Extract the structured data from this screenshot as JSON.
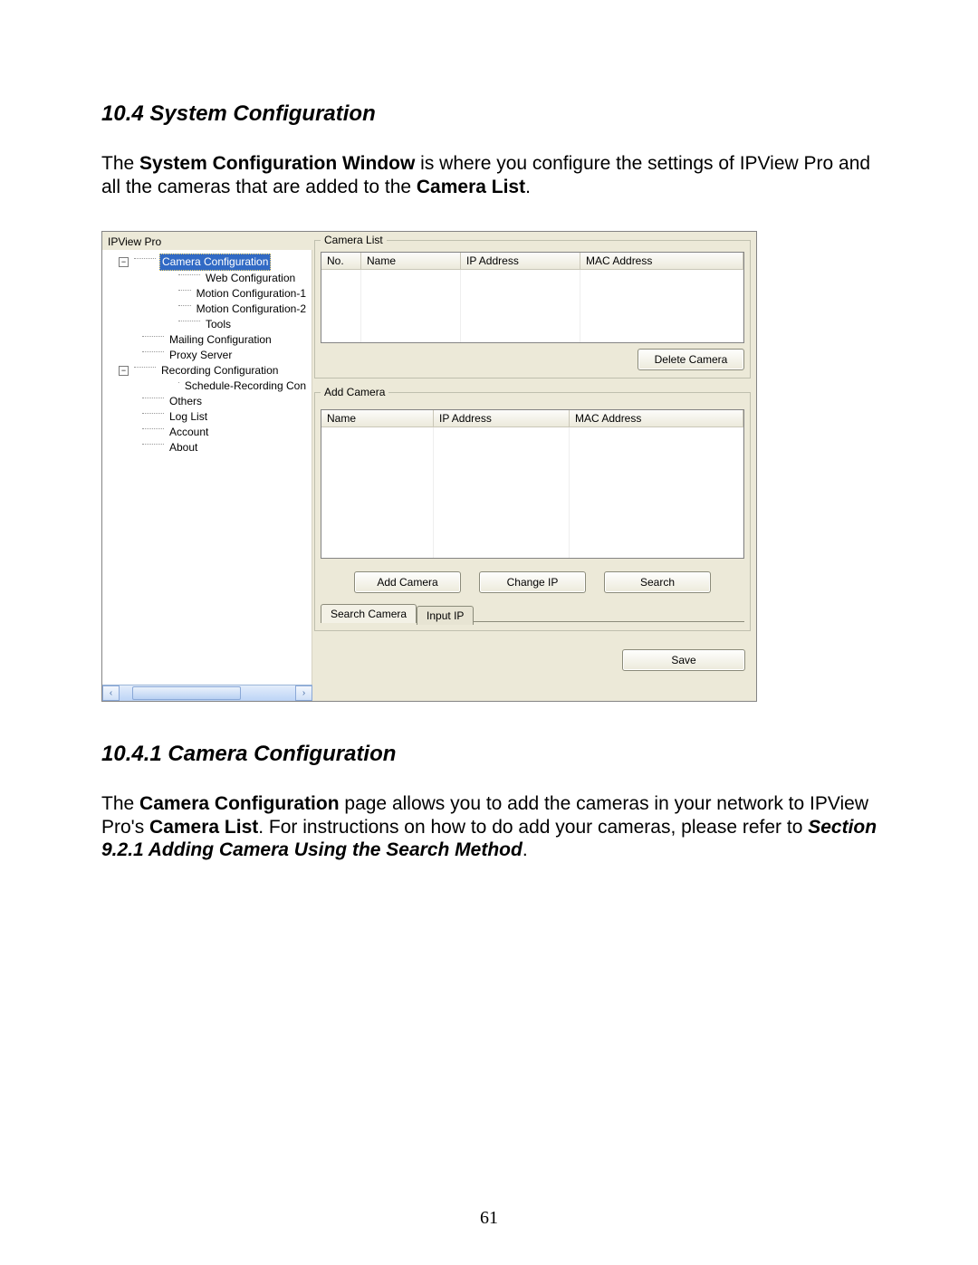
{
  "doc": {
    "section_heading": "10.4 System Configuration",
    "para1_pre": "The ",
    "para1_bold": "System Configuration Window",
    "para1_mid": " is where you configure the settings of IPView Pro and all the cameras that are added to the ",
    "para1_bold2": "Camera List",
    "para1_end": ".",
    "sub_heading": "10.4.1 Camera Configuration",
    "para2_pre": "The ",
    "para2_bold": "Camera Configuration",
    "para2_mid": " page allows you to add the cameras in your network to IPView Pro's ",
    "para2_bold2": "Camera List",
    "para2_mid2": ". For instructions on how to do add your cameras, please refer to ",
    "para2_ital": "Section 9.2.1 Adding Camera Using the Search Method",
    "para2_end": ".",
    "page_number": "61"
  },
  "win": {
    "title": "IPView Pro",
    "tree": {
      "camera_cfg": "Camera Configuration",
      "web_cfg": "Web Configuration",
      "motion1": "Motion Configuration-1",
      "motion2": "Motion Configuration-2",
      "tools": "Tools",
      "mailing": "Mailing Configuration",
      "proxy": "Proxy Server",
      "recording": "Recording Configuration",
      "schedule": "Schedule-Recording Con",
      "others": "Others",
      "loglist": "Log List",
      "account": "Account",
      "about": "About",
      "minus": "−"
    },
    "camera_list": {
      "legend": "Camera List",
      "col_no": "No.",
      "col_name": "Name",
      "col_ip": "IP Address",
      "col_mac": "MAC Address",
      "delete_btn": "Delete Camera"
    },
    "add_camera": {
      "legend": "Add Camera",
      "col_name": "Name",
      "col_ip": "IP Address",
      "col_mac": "MAC Address",
      "add_btn": "Add Camera",
      "change_ip_btn": "Change IP",
      "search_btn": "Search",
      "tab_search": "Search Camera",
      "tab_input": "Input IP"
    },
    "save_btn": "Save"
  }
}
